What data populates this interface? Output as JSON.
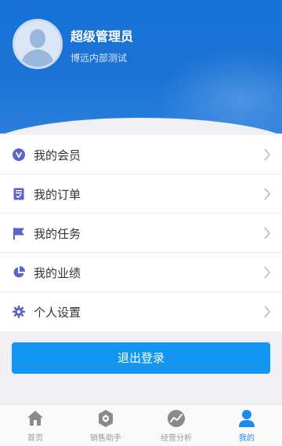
{
  "profile": {
    "name": "超级管理员",
    "subtitle": "博远内部测试"
  },
  "menu": {
    "items": [
      {
        "label": "我的会员",
        "icon": "v-badge-icon"
      },
      {
        "label": "我的订单",
        "icon": "clipboard-check-icon"
      },
      {
        "label": "我的任务",
        "icon": "flag-icon"
      },
      {
        "label": "我的业绩",
        "icon": "pie-chart-icon"
      },
      {
        "label": "个人设置",
        "icon": "gear-icon"
      }
    ]
  },
  "logout": {
    "label": "退出登录"
  },
  "tabbar": {
    "items": [
      {
        "label": "首页",
        "icon": "home-icon"
      },
      {
        "label": "销售助手",
        "icon": "tag-icon"
      },
      {
        "label": "经营分析",
        "icon": "trend-icon"
      },
      {
        "label": "我的",
        "icon": "user-icon",
        "active": true
      }
    ]
  },
  "colors": {
    "header": "#1a72d4",
    "menu_icon": "#5b64c8",
    "logout_button": "#1296f2",
    "tab_active": "#1a8cf0",
    "tab_inactive": "#999999"
  }
}
